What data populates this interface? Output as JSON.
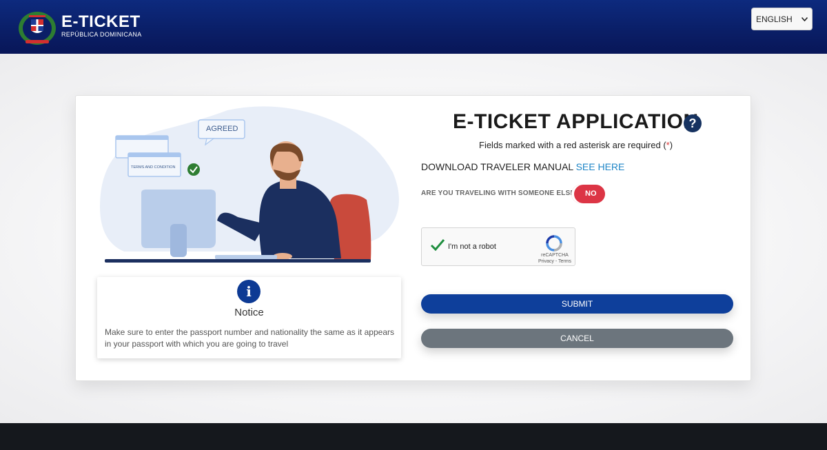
{
  "header": {
    "brand_title": "E-TICKET",
    "brand_subtitle": "REPÚBLICA DOMINICANA",
    "language": "ENGLISH"
  },
  "illustration": {
    "agreed_label": "AGREED",
    "terms_label": "TERMS AND CONDITION"
  },
  "notice": {
    "icon": "i",
    "title": "Notice",
    "body": "Make sure to enter the passport number and nationality the same as it appears in your passport with which you are going to travel"
  },
  "form": {
    "title": "E-TICKET APPLICATION",
    "help_icon": "?",
    "required_text": "Fields marked with a red asterisk are required (",
    "required_asterisk": "*",
    "required_close": ")",
    "manual_text": "DOWNLOAD TRAVELER MANUAL",
    "manual_link": "SEE HERE",
    "traveling_question": "ARE YOU TRAVELING WITH SOMEONE ELSE?",
    "traveling_toggle": "NO",
    "captcha_label": "I'm not a robot",
    "captcha_brand": "reCAPTCHA",
    "captcha_links": "Privacy - Terms",
    "submit_label": "SUBMIT",
    "cancel_label": "CANCEL"
  },
  "colors": {
    "header": "#0a1e66",
    "primary": "#0e3f9b",
    "danger": "#dc3545",
    "secondary": "#6c757d",
    "link": "#1f86c7"
  }
}
